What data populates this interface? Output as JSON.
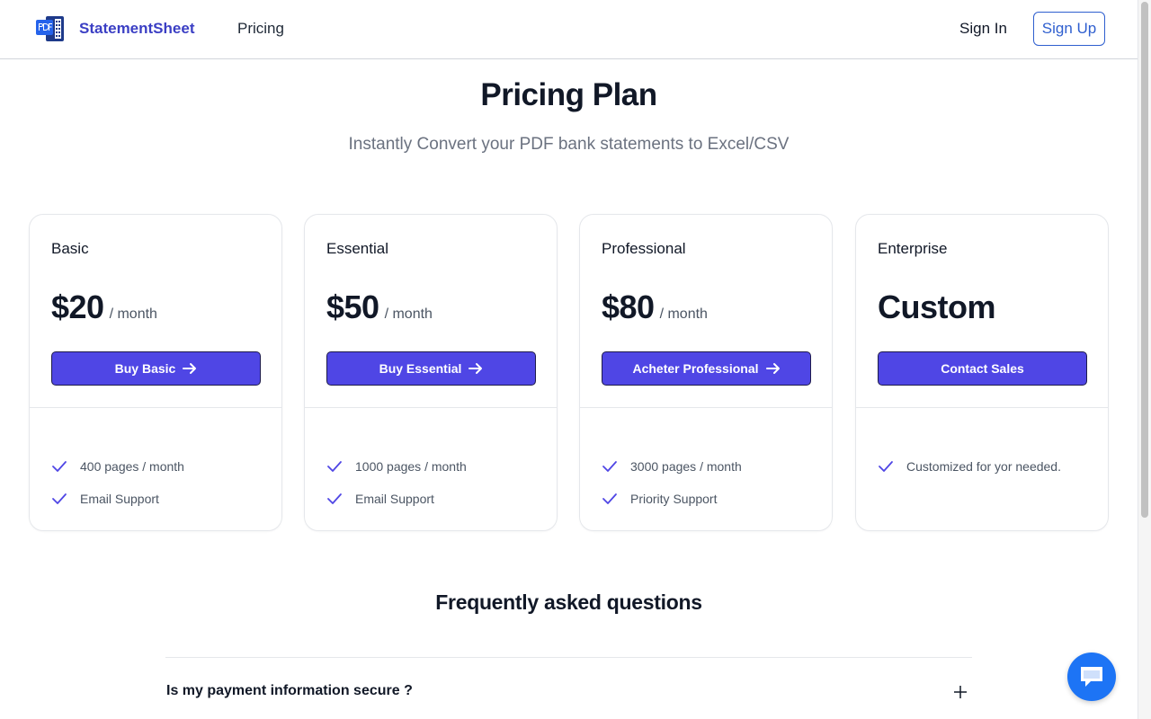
{
  "header": {
    "brand": "StatementSheet",
    "logo_icon": "pdf-document-icon",
    "nav": [
      {
        "label": "Pricing"
      }
    ],
    "sign_in": "Sign In",
    "sign_up": "Sign Up"
  },
  "hero": {
    "title": "Pricing Plan",
    "subtitle": "Instantly Convert your PDF bank statements to Excel/CSV"
  },
  "plans": [
    {
      "name": "Basic",
      "price": "$20",
      "period": "/ month",
      "button": "Buy Basic",
      "features": [
        "400 pages / month",
        "Email Support"
      ]
    },
    {
      "name": "Essential",
      "price": "$50",
      "period": "/ month",
      "button": "Buy Essential",
      "features": [
        "1000 pages / month",
        "Email Support"
      ]
    },
    {
      "name": "Professional",
      "price": "$80",
      "period": "/ month",
      "button": "Acheter Professional",
      "features": [
        "3000 pages / month",
        "Priority Support"
      ]
    },
    {
      "name": "Enterprise",
      "price": "Custom",
      "button": "Contact Sales",
      "features": [
        "Customized for yor needed."
      ]
    }
  ],
  "faq": {
    "title": "Frequently asked questions",
    "items": [
      {
        "question": "Is my payment information secure ?"
      }
    ]
  },
  "colors": {
    "brand": "#3b3fc4",
    "primary_button": "#4f46e5",
    "sign_up_border": "#2f5fcf",
    "chat_button": "#1d74f5"
  }
}
